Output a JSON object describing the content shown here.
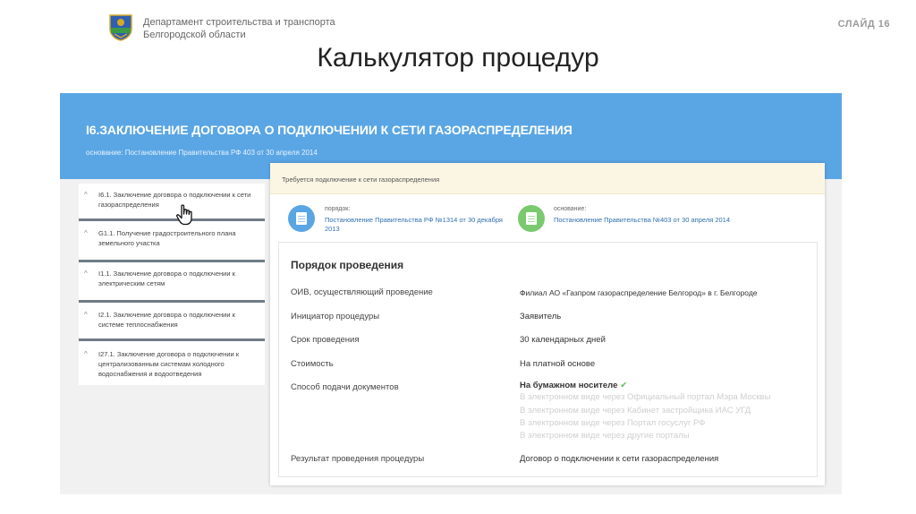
{
  "header": {
    "dept_line1": "Департамент строительства и транспорта",
    "dept_line2": "Белгородской области",
    "slide": "СЛАЙД 16",
    "title": "Калькулятор процедур"
  },
  "band": {
    "title": "I6.ЗАКЛЮЧЕНИЕ ДОГОВОРА О ПОДКЛЮЧЕНИИ К СЕТИ ГАЗОРАСПРЕДЕЛЕНИЯ",
    "basis": "основание: Постановление Правительства РФ 403 от 30 апреля 2014"
  },
  "sidebar": {
    "items": [
      {
        "label": "I6.1. Заключение договора о подключении к сети газораспределения"
      },
      {
        "label": "G1.1. Получение градостроительного плана земельного участка"
      },
      {
        "label": "I1.1. Заключение договора о подключении к электрическим сетям"
      },
      {
        "label": "I2.1. Заключение договора о подключении к системе теплоснабжения"
      },
      {
        "label": "I27.1. Заключение договора о подключении к централизованным системам холодного водоснабжения и водоотведения"
      }
    ]
  },
  "panel": {
    "notice": "Требуется подключение к сети газораспределения",
    "order_label": "порядок:",
    "order_line1": "Постановление Правительства РФ №1314 от 30 декабря",
    "order_line2": "2013",
    "basis_label": "основание:",
    "basis_link": "Постановление Правительства №403 от 30 апреля 2014",
    "section_title": "Порядок проведения",
    "rows": [
      {
        "label": "ОИВ, осуществляющий проведение",
        "value": "Филиал АО «Газпром газораспределение Белгород» в г. Белгороде"
      },
      {
        "label": "Инициатор процедуры",
        "value": "Заявитель"
      },
      {
        "label": "Срок проведения",
        "value": "30  календарных дней"
      },
      {
        "label": "Стоимость",
        "value": "На платной основе"
      },
      {
        "label": "Способ подачи документов",
        "value": "На бумажном носителе"
      }
    ],
    "submission_options": [
      "В электронном виде через Официальный портал Мэра Москвы",
      "В электронном виде через Кабинет застройщика ИАС УГД",
      "В электронном виде через Портал госуслуг РФ",
      "В электронном виде через другие порталы"
    ],
    "result_label": "Результат проведения процедуры",
    "result_value": "Договор о подключении к сети газораспределения"
  },
  "colors": {
    "band_blue": "#5aa6e4",
    "notice_bg": "#fbf6e4",
    "link_blue": "#2f6fb0",
    "check_green": "#5cb85c"
  },
  "icons": {
    "emblem": "coat-of-arms-icon",
    "cursor": "hand-pointer-icon",
    "check": "check-icon"
  }
}
